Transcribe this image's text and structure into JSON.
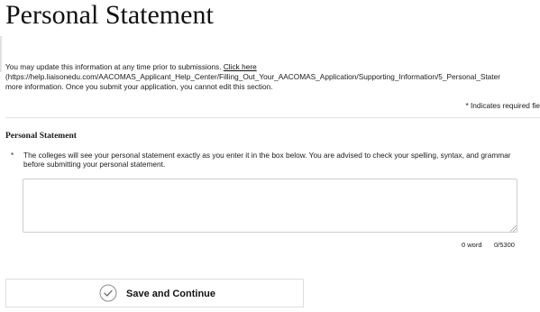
{
  "page": {
    "title": "Personal Statement"
  },
  "info": {
    "text_before_link": "You may update this information at any time prior to submissions. ",
    "link_label": "Click here",
    "link_url_text": "(https://help.liaisonedu.com/AACOMAS_Applicant_Help_Center/Filling_Out_Your_AACOMAS_Application/Supporting_Information/5_Personal_Stater",
    "text_after_link": "more information. Once you submit your application, you cannot edit this section."
  },
  "required_note": "* Indicates required fie",
  "section": {
    "title": "Personal Statement",
    "question_marker": "*",
    "question_text": "The colleges will see your personal statement exactly as you enter it in the box below. You are advised to check your spelling, syntax, and grammar before submitting your personal statement.",
    "answer_value": ""
  },
  "counters": {
    "words": "0 word",
    "characters": "0/5300"
  },
  "actions": {
    "save_label": "Save and Continue",
    "save_icon": "checkmark-circle-icon"
  },
  "colors": {
    "text": "#111111",
    "border": "#cfcfcf",
    "divider": "#e2e2e2"
  }
}
